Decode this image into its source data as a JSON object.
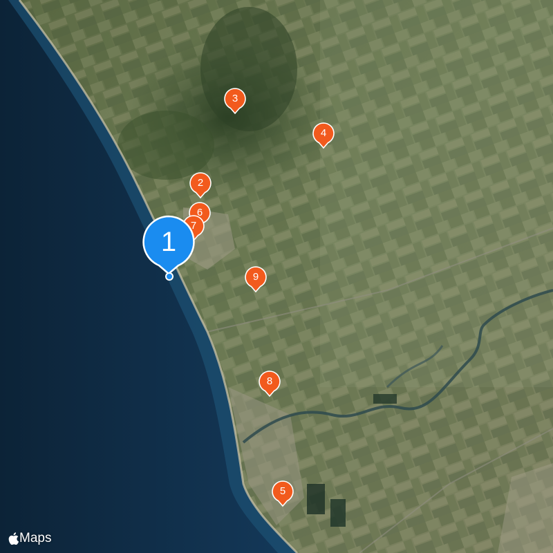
{
  "map": {
    "view": "satellite",
    "colors": {
      "sea": "#0f2c45",
      "land": "#6f7a55",
      "pin_orange": "#f25a1d",
      "pin_blue": "#1a8cf0",
      "location_dot": "#1a8cf0"
    },
    "selected_pin": {
      "label": "1"
    },
    "pins": [
      {
        "label": "2"
      },
      {
        "label": "3"
      },
      {
        "label": "4"
      },
      {
        "label": "5"
      },
      {
        "label": "6"
      },
      {
        "label": "7"
      },
      {
        "label": "8"
      },
      {
        "label": "9"
      }
    ]
  },
  "attribution": {
    "text": "Maps",
    "logo_icon": "apple-logo-icon"
  }
}
